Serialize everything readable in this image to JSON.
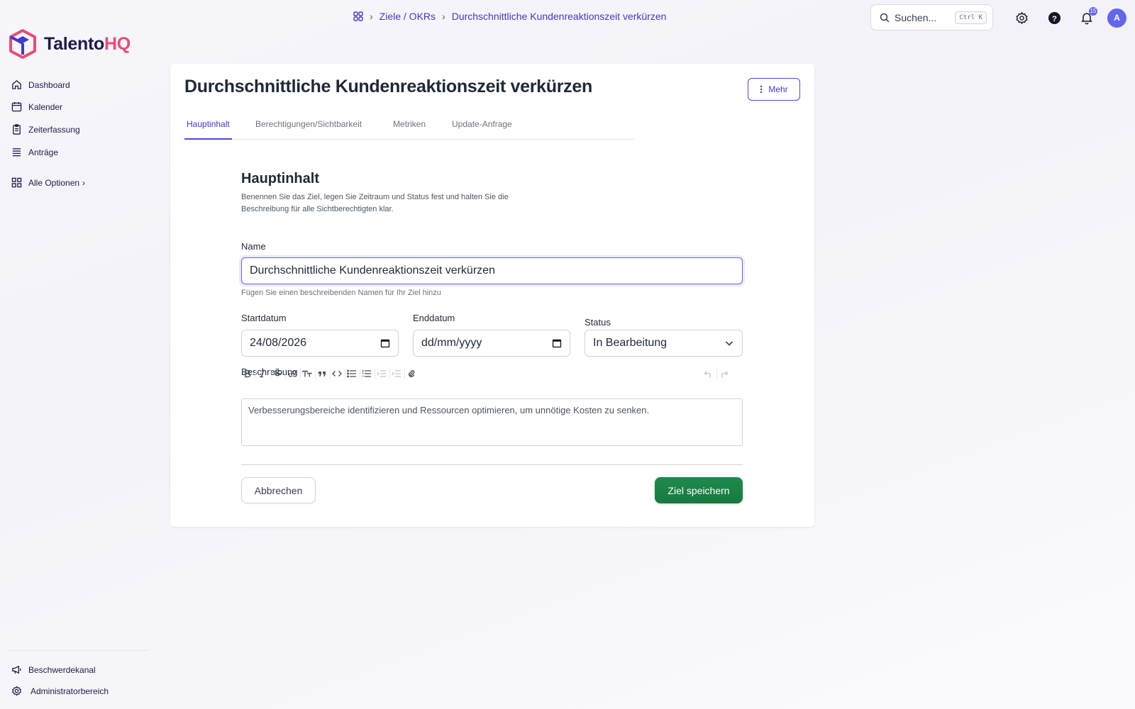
{
  "app": {
    "logo_main": "Talento",
    "logo_accent": "HQ"
  },
  "breadcrumb": {
    "items": [
      "Ziele / OKRs",
      "Durchschnittliche Kundenreaktionszeit verkürzen"
    ]
  },
  "header": {
    "search_placeholder": "Suchen...",
    "search_shortcut": "Ctrl K",
    "notification_count": "15",
    "avatar_initial": "A"
  },
  "sidebar": {
    "items": [
      {
        "label": "Dashboard",
        "icon": "home-icon"
      },
      {
        "label": "Kalender",
        "icon": "calendar-icon"
      },
      {
        "label": "Zeiterfassung",
        "icon": "clipboard-icon"
      },
      {
        "label": "Anträge",
        "icon": "list-icon"
      },
      {
        "label": "Alle Optionen",
        "icon": "grid-icon"
      }
    ],
    "bottom_items": [
      {
        "label": "Beschwerdekanal",
        "icon": "megaphone-icon"
      },
      {
        "label": "Administratorbereich",
        "icon": "gear-icon"
      }
    ]
  },
  "page": {
    "title": "Durchschnittliche Kundenreaktionszeit verkürzen",
    "more_label": "Mehr",
    "tabs": [
      {
        "label": "Hauptinhalt",
        "active": true
      },
      {
        "label": "Berechtigungen/Sichtbarkeit",
        "active": false
      },
      {
        "label": "Metriken",
        "active": false
      },
      {
        "label": "Update-Anfrage",
        "active": false
      }
    ]
  },
  "form": {
    "section_title": "Hauptinhalt",
    "section_description": "Benennen Sie das Ziel, legen Sie Zeitraum und Status fest und halten Sie die Beschreibung für alle Sichtberechtigten klar.",
    "name_label": "Name",
    "name_value": "Durchschnittliche Kundenreaktionszeit verkürzen",
    "name_hint": "Fügen Sie einen beschreibenden Namen für Ihr Ziel hinzu",
    "start_label": "Startdatum",
    "start_value": "24/08/2026",
    "end_label": "Enddatum",
    "end_value": "dd/mm/yyyy",
    "status_label": "Status",
    "status_value": "In Bearbeitung",
    "description_label": "Beschreibung",
    "description_value": "Verbesserungsbereiche identifizieren und Ressourcen optimieren, um unnötige Kosten zu senken.",
    "cancel_label": "Abbrechen",
    "save_label": "Ziel speichern"
  },
  "colors": {
    "accent": "#4f46e5",
    "brand_pink": "#ec4b74",
    "save_green": "#1a7f44"
  }
}
